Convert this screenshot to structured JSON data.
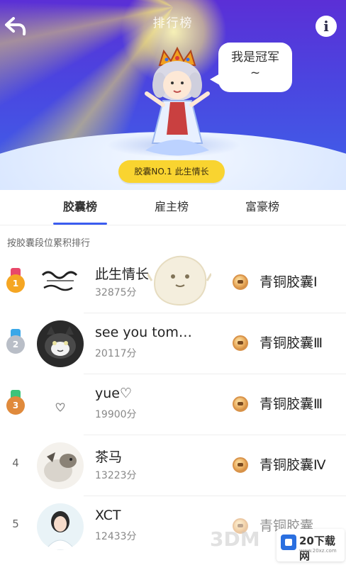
{
  "header": {
    "title": "排行榜",
    "back_icon": "back-arrow-icon",
    "info_label": "i"
  },
  "hero": {
    "speech": "我是冠军\n~",
    "champion_badge": "胶囊NO.1 此生情长"
  },
  "tabs": [
    {
      "label": "胶囊榜",
      "active": true
    },
    {
      "label": "雇主榜",
      "active": false
    },
    {
      "label": "富豪榜",
      "active": false
    }
  ],
  "section_caption": "按胶囊段位累积排行",
  "rows": [
    {
      "rank": "1",
      "name": "此生情长",
      "score": "32875分",
      "tier": "青铜胶囊Ⅰ",
      "medal_color": "#f5a623",
      "ribbon_color": "#e8486a"
    },
    {
      "rank": "2",
      "name": "see you tom…",
      "score": "20117分",
      "tier": "青铜胶囊Ⅲ",
      "medal_color": "#b9bec7",
      "ribbon_color": "#3aa7e8"
    },
    {
      "rank": "3",
      "name": "yue♡",
      "score": "19900分",
      "tier": "青铜胶囊Ⅲ",
      "medal_color": "#e08a3c",
      "ribbon_color": "#3cc47a"
    },
    {
      "rank": "4",
      "name": "茶马",
      "score": "13223分",
      "tier": "青铜胶囊Ⅳ"
    },
    {
      "rank": "5",
      "name": "XCT",
      "score": "12433分",
      "tier": "青铜胶囊"
    }
  ],
  "watermarks": {
    "brand_a": "3DM",
    "brand_b": "20下载网",
    "brand_b_url": "www.20xz.com"
  },
  "colors": {
    "accent": "#3b5cf0",
    "badge": "#f9d430",
    "hero_top": "#5b2fd6"
  }
}
